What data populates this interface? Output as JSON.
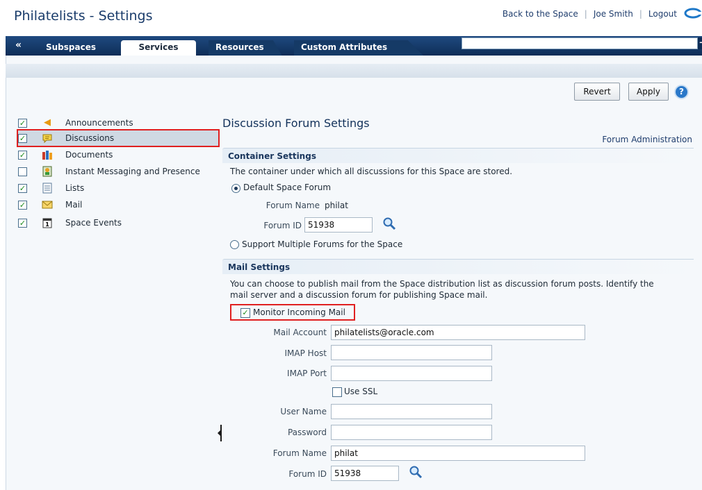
{
  "header": {
    "title": "Philatelists - Settings",
    "links": [
      "Back to the Space",
      "Joe Smith",
      "Logout"
    ]
  },
  "tabs": [
    {
      "label": "Subspaces",
      "active": false
    },
    {
      "label": "Services",
      "active": true
    },
    {
      "label": "Resources",
      "active": false
    },
    {
      "label": "Custom Attributes",
      "active": false
    }
  ],
  "toolbar": {
    "revert_label": "Revert",
    "apply_label": "Apply",
    "help_glyph": "?"
  },
  "services": [
    {
      "label": "Announcements",
      "checked": true,
      "icon": "megaphone-icon",
      "glyph": "📣"
    },
    {
      "label": "Discussions",
      "checked": true,
      "icon": "speech-bubble-icon",
      "glyph": "💬",
      "selected": true
    },
    {
      "label": "Documents",
      "checked": true,
      "icon": "books-icon",
      "glyph": "📚"
    },
    {
      "label": "Instant Messaging and Presence",
      "checked": false,
      "icon": "im-presence-icon",
      "glyph": "👥"
    },
    {
      "label": "Lists",
      "checked": true,
      "icon": "list-icon",
      "glyph": "≣"
    },
    {
      "label": "Mail",
      "checked": true,
      "icon": "envelope-icon",
      "glyph": "✉"
    },
    {
      "label": "Space Events",
      "checked": true,
      "icon": "calendar-icon",
      "glyph": "1"
    }
  ],
  "main": {
    "title": "Discussion Forum Settings",
    "forum_admin_link": "Forum Administration",
    "container": {
      "header": "Container Settings",
      "description": "The container under which all discussions for this Space are stored.",
      "option_default": "Default Space Forum",
      "forum_name_label": "Forum Name",
      "forum_name_value": "philat",
      "forum_id_label": "Forum ID",
      "forum_id_value": "51938",
      "option_multiple": "Support Multiple Forums for the Space"
    },
    "mail": {
      "header": "Mail Settings",
      "description_line1": "You can choose to publish mail from the Space distribution list as discussion forum posts. Identify the",
      "description_line2": "mail server and a discussion forum for publishing Space mail.",
      "monitor_label": "Monitor Incoming Mail",
      "monitor_checked": true,
      "mail_account_label": "Mail Account",
      "mail_account_value": "philatelists@oracle.com",
      "imap_host_label": "IMAP Host",
      "imap_host_value": "",
      "imap_port_label": "IMAP Port",
      "imap_port_value": "",
      "use_ssl_label": "Use SSL",
      "use_ssl_checked": false,
      "user_name_label": "User Name",
      "user_name_value": "",
      "password_label": "Password",
      "password_value": "",
      "forum_name_label": "Forum Name",
      "forum_name_value": "philat",
      "forum_id_label": "Forum ID",
      "forum_id_value": "51938"
    }
  },
  "colors": {
    "brand_blue": "#1a3c6b",
    "highlight_red": "#e02020",
    "check_green": "#1c8a1c"
  }
}
